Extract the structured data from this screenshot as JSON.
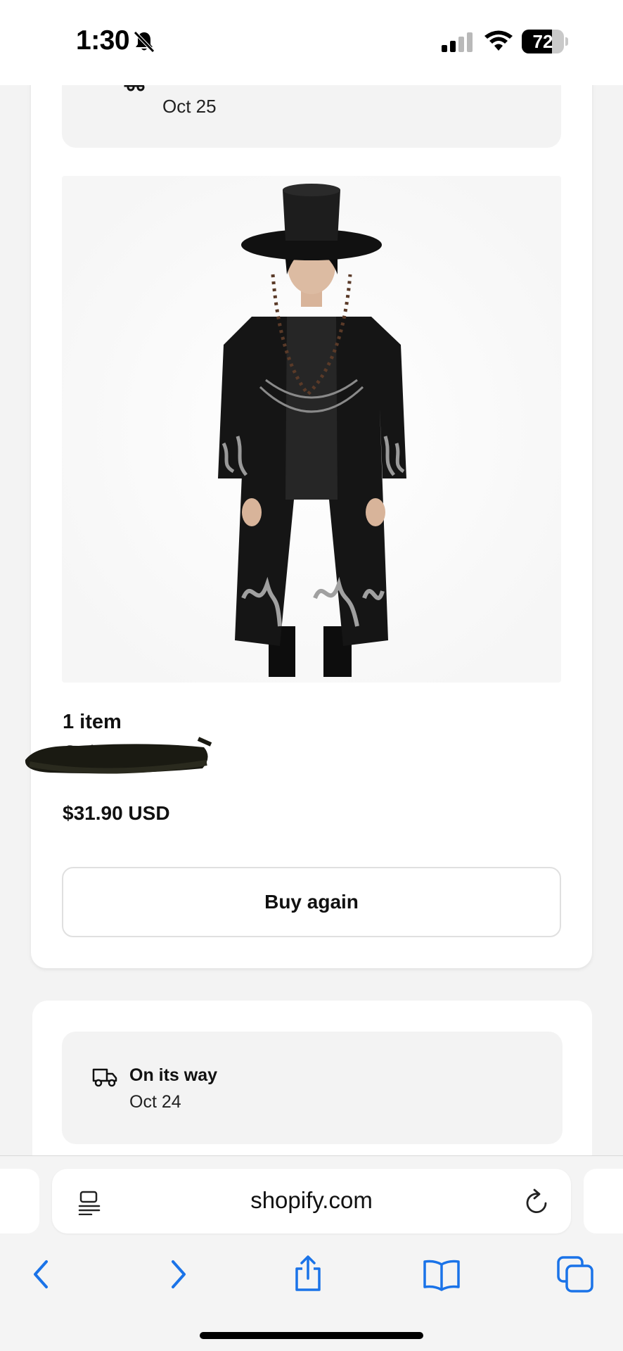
{
  "status_bar": {
    "time": "1:30",
    "battery_level": "72",
    "battery_fraction": 0.72
  },
  "orders": [
    {
      "shipment_date": "Oct 25",
      "item_count": "1 item",
      "order_number": "Order #2875",
      "price": "$31.90 USD",
      "buy_again_label": "Buy again"
    },
    {
      "status": "On its way",
      "shipment_date": "Oct 24"
    }
  ],
  "browser": {
    "url": "shopify.com"
  },
  "icons": {
    "status": [
      "bell-slash-icon",
      "signal-icon",
      "wifi-icon",
      "battery-icon"
    ],
    "toolbar": [
      "back-icon",
      "forward-icon",
      "share-icon",
      "bookmarks-icon",
      "tabs-icon"
    ]
  },
  "colors": {
    "accent": "#1a73e8",
    "page_bg": "#f3f3f3",
    "card_bg": "#ffffff",
    "status_box_bg": "#f3f3f3"
  }
}
